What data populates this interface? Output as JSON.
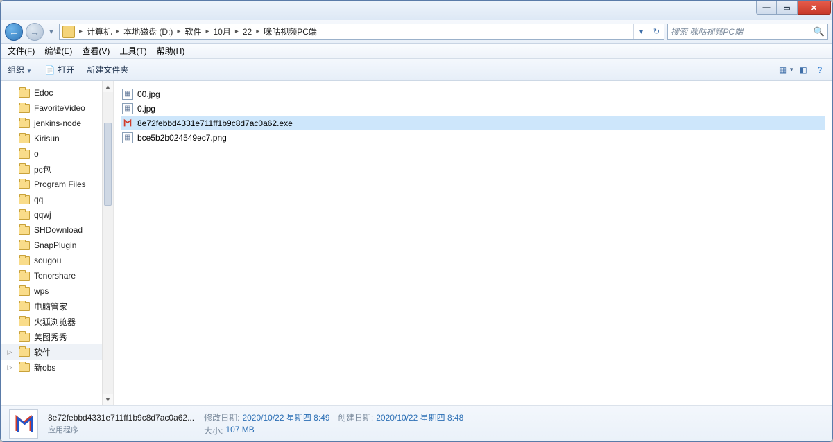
{
  "breadcrumb": {
    "items": [
      "计算机",
      "本地磁盘 (D:)",
      "软件",
      "10月",
      "22",
      "咪咕视频PC端"
    ]
  },
  "search": {
    "placeholder": "搜索 咪咕视频PC端"
  },
  "menu": {
    "file": "文件(F)",
    "edit": "编辑(E)",
    "view": "查看(V)",
    "tools": "工具(T)",
    "help": "帮助(H)"
  },
  "toolbar": {
    "organize": "组织",
    "open": "打开",
    "newfolder": "新建文件夹"
  },
  "tree": {
    "items": [
      {
        "label": "Edoc"
      },
      {
        "label": "FavoriteVideo"
      },
      {
        "label": "jenkins-node"
      },
      {
        "label": "Kirisun"
      },
      {
        "label": "o"
      },
      {
        "label": "pc包"
      },
      {
        "label": "Program Files"
      },
      {
        "label": "qq"
      },
      {
        "label": "qqwj"
      },
      {
        "label": "SHDownload"
      },
      {
        "label": "SnapPlugin"
      },
      {
        "label": "sougou"
      },
      {
        "label": "Tenorshare"
      },
      {
        "label": "wps"
      },
      {
        "label": "电脑管家"
      },
      {
        "label": "火狐浏览器"
      },
      {
        "label": "美图秀秀"
      },
      {
        "label": "软件",
        "selected": true,
        "expandable": true
      },
      {
        "label": "新obs",
        "expandable": true
      }
    ]
  },
  "files": {
    "items": [
      {
        "name": "00.jpg",
        "type": "img"
      },
      {
        "name": "0.jpg",
        "type": "img"
      },
      {
        "name": "8e72febbd4331e711ff1b9c8d7ac0a62.exe",
        "type": "exe",
        "selected": true
      },
      {
        "name": "bce5b2b024549ec7.png",
        "type": "img"
      }
    ]
  },
  "details": {
    "name": "8e72febbd4331e711ff1b9c8d7ac0a62...",
    "type": "应用程序",
    "mod_label": "修改日期:",
    "mod_value": "2020/10/22 星期四 8:49",
    "create_label": "创建日期:",
    "create_value": "2020/10/22 星期四 8:48",
    "size_label": "大小:",
    "size_value": "107 MB"
  }
}
